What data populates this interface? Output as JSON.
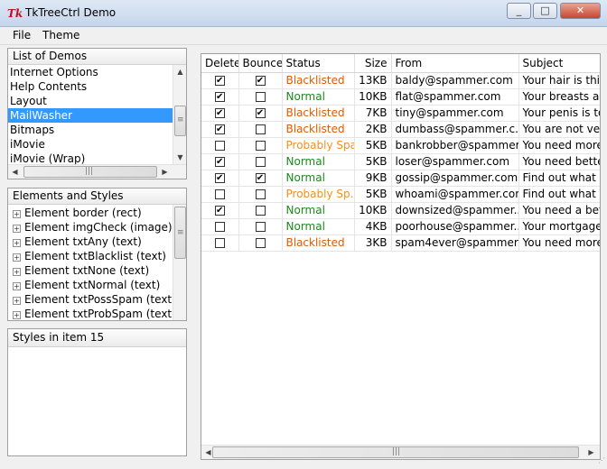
{
  "window": {
    "title": "TkTreeCtrl Demo",
    "icon": "Tk",
    "minimize": "_",
    "maximize": "□",
    "close": "✕"
  },
  "menu": [
    "File",
    "Theme"
  ],
  "demos": {
    "header": "List of Demos",
    "items": [
      "Internet Options",
      "Help Contents",
      "Layout",
      "MailWasher",
      "Bitmaps",
      "iMovie",
      "iMovie (Wrap)"
    ],
    "selected_index": 3
  },
  "elements": {
    "header": "Elements and Styles",
    "items": [
      "Element border (rect)",
      "Element imgCheck (image)",
      "Element txtAny (text)",
      "Element txtBlacklist (text)",
      "Element txtNone (text)",
      "Element txtNormal (text)",
      "Element txtPossSpam (text)",
      "Element txtProbSpam (text)"
    ]
  },
  "styles_header": "Styles in item 15",
  "mail": {
    "columns": [
      "Delete",
      "Bounce",
      "Status",
      "Size",
      "From",
      "Subject"
    ],
    "status_colors": {
      "Blacklisted": "#e05a00",
      "Normal": "#1a8a1a",
      "Probably Sp...": "#f09020"
    },
    "rows": [
      {
        "delete": true,
        "bounce": true,
        "status": "Blacklisted",
        "size": "13KB",
        "from": "baldy@spammer.com",
        "subject": "Your hair is thi"
      },
      {
        "delete": true,
        "bounce": false,
        "status": "Normal",
        "size": "10KB",
        "from": "flat@spammer.com",
        "subject": "Your breasts ar"
      },
      {
        "delete": true,
        "bounce": true,
        "status": "Blacklisted",
        "size": "7KB",
        "from": "tiny@spammer.com",
        "subject": "Your penis is to"
      },
      {
        "delete": true,
        "bounce": false,
        "status": "Blacklisted",
        "size": "2KB",
        "from": "dumbass@spammer.c...",
        "subject": "You are not ve"
      },
      {
        "delete": false,
        "bounce": false,
        "status": "Probably Spa...",
        "size": "5KB",
        "from": "bankrobber@spammer...",
        "subject": "You need more"
      },
      {
        "delete": true,
        "bounce": false,
        "status": "Normal",
        "size": "5KB",
        "from": "loser@spammer.com",
        "subject": "You need bette"
      },
      {
        "delete": true,
        "bounce": true,
        "status": "Normal",
        "size": "9KB",
        "from": "gossip@spammer.com",
        "subject": "Find out what y"
      },
      {
        "delete": false,
        "bounce": false,
        "status": "Probably Sp...",
        "size": "5KB",
        "from": "whoami@spammer.com",
        "subject": "Find out what y"
      },
      {
        "delete": true,
        "bounce": false,
        "status": "Normal",
        "size": "10KB",
        "from": "downsized@spammer....",
        "subject": "You need a bet"
      },
      {
        "delete": false,
        "bounce": false,
        "status": "Normal",
        "size": "4KB",
        "from": "poorhouse@spammer....",
        "subject": "Your mortgage"
      },
      {
        "delete": false,
        "bounce": false,
        "status": "Blacklisted",
        "size": "3KB",
        "from": "spam4ever@spammer....",
        "subject": "You need more"
      }
    ]
  },
  "icons": {
    "scroll_up": "▲",
    "scroll_down": "▼",
    "scroll_left": "◀",
    "scroll_right": "▶",
    "grip_v": "≡",
    "grip_h": "|||",
    "expand": "+",
    "check": "✔"
  }
}
